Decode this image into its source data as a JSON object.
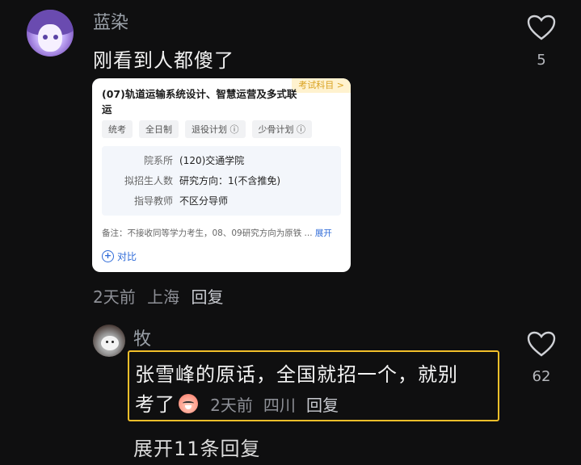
{
  "comment1": {
    "username": "蓝染",
    "text": "刚看到人都傻了",
    "meta": {
      "time": "2天前",
      "location": "上海",
      "reply": "回复"
    },
    "likes": "5"
  },
  "card": {
    "badge": "考试科目 >",
    "title": "(07)轨道运输系统设计、智慧运营及多式联运",
    "tags": [
      "统考",
      "全日制",
      "退役计划 ⓘ",
      "少骨计划 ⓘ"
    ],
    "rows": [
      {
        "key": "院系所",
        "value": "(120)交通学院"
      },
      {
        "key": "拟招生人数",
        "value": "研究方向：1(不含推免)"
      },
      {
        "key": "指导教师",
        "value": "不区分导师"
      }
    ],
    "note": "备注：不接收同等学力考生，08、09研究方向为原铁 ...",
    "note_more": "展开",
    "compare": "对比"
  },
  "comment2": {
    "username": "牧",
    "text_line1": "张雪峰的原话，全国就招一个，就别",
    "text_line2": "考了",
    "meta": {
      "time": "2天前",
      "location": "四川",
      "reply": "回复"
    },
    "likes": "62"
  },
  "expand_replies": "展开11条回复",
  "colors": {
    "highlight": "#f2bf2a",
    "link": "#2f6bd8",
    "background": "#0f0f10"
  }
}
